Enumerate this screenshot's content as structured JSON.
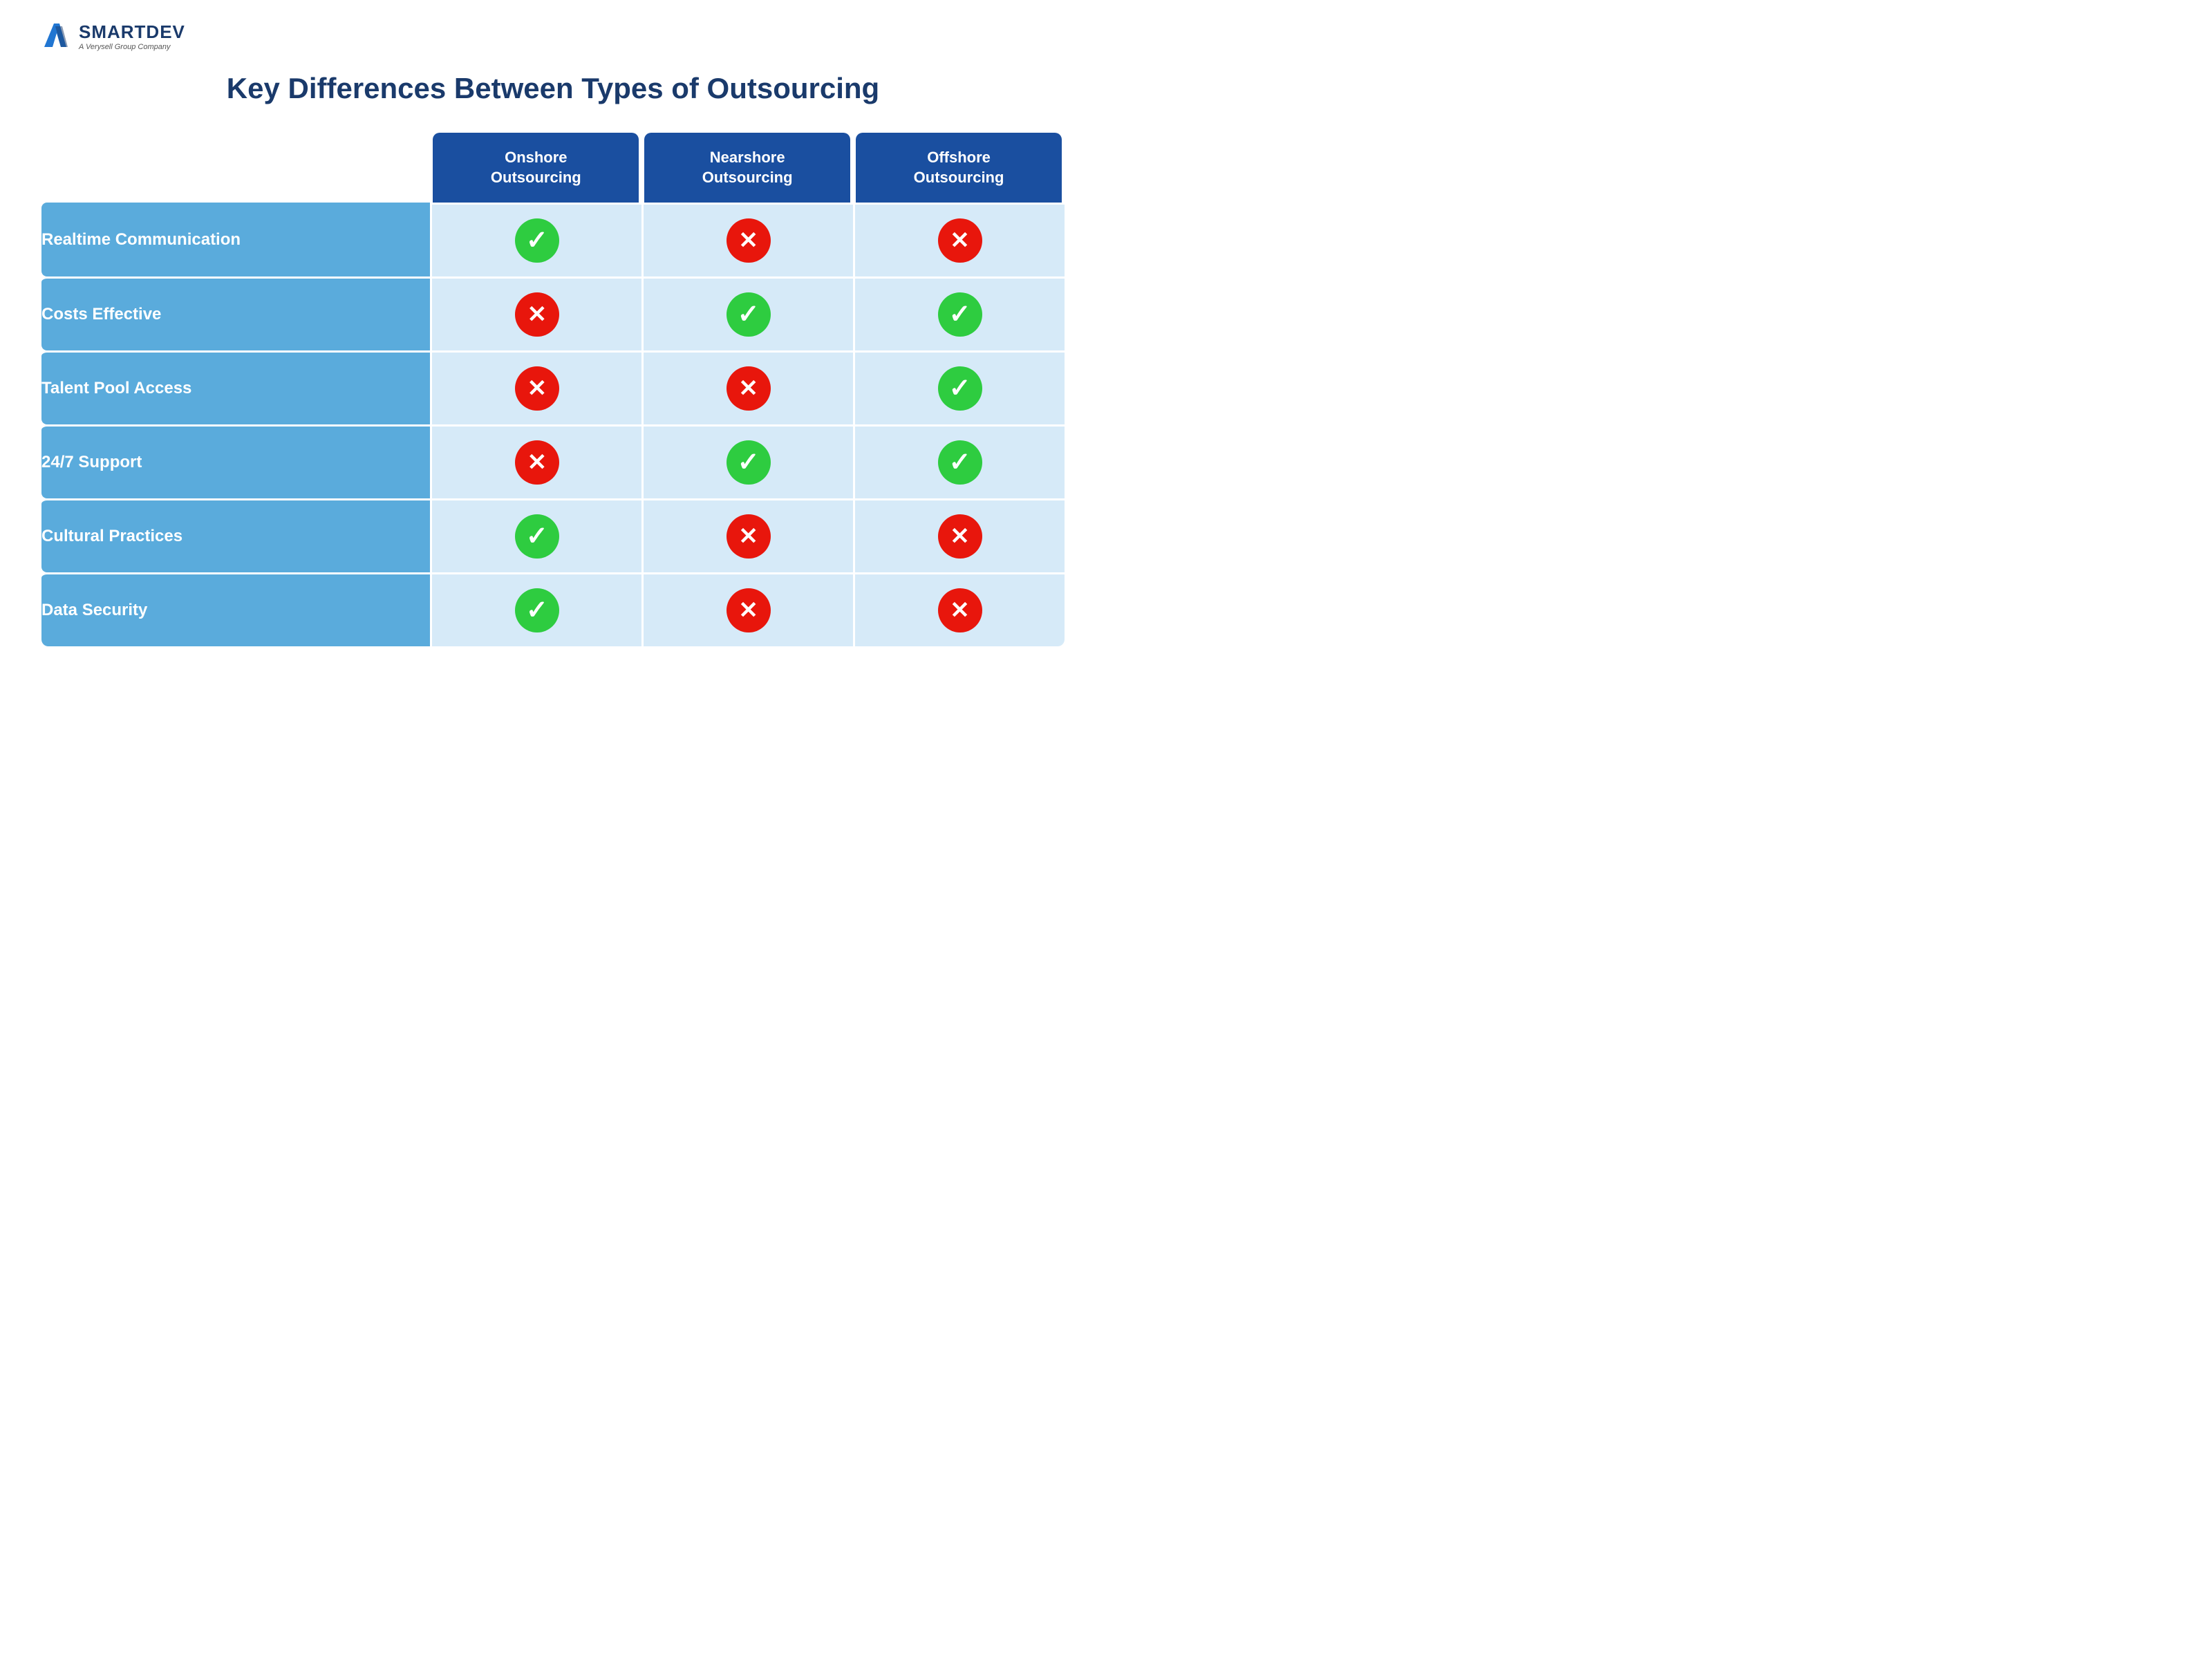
{
  "logo": {
    "brand": "SMARTDEV",
    "subtitle": "A Verysell Group Company"
  },
  "title": "Key Differences Between Types of Outsourcing",
  "columns": [
    {
      "label": "Onshore\nOutsourcing"
    },
    {
      "label": "Nearshore\nOutsourcing"
    },
    {
      "label": "Offshore\nOutsourcing"
    }
  ],
  "rows": [
    {
      "label": "Realtime Communication",
      "values": [
        "check",
        "cross",
        "cross"
      ]
    },
    {
      "label": "Costs Effective",
      "values": [
        "cross",
        "check",
        "check"
      ]
    },
    {
      "label": "Talent Pool Access",
      "values": [
        "cross",
        "cross",
        "check"
      ]
    },
    {
      "label": "24/7 Support",
      "values": [
        "cross",
        "check",
        "check"
      ]
    },
    {
      "label": "Cultural Practices",
      "values": [
        "check",
        "cross",
        "cross"
      ]
    },
    {
      "label": "Data Security",
      "values": [
        "check",
        "cross",
        "cross"
      ]
    }
  ]
}
